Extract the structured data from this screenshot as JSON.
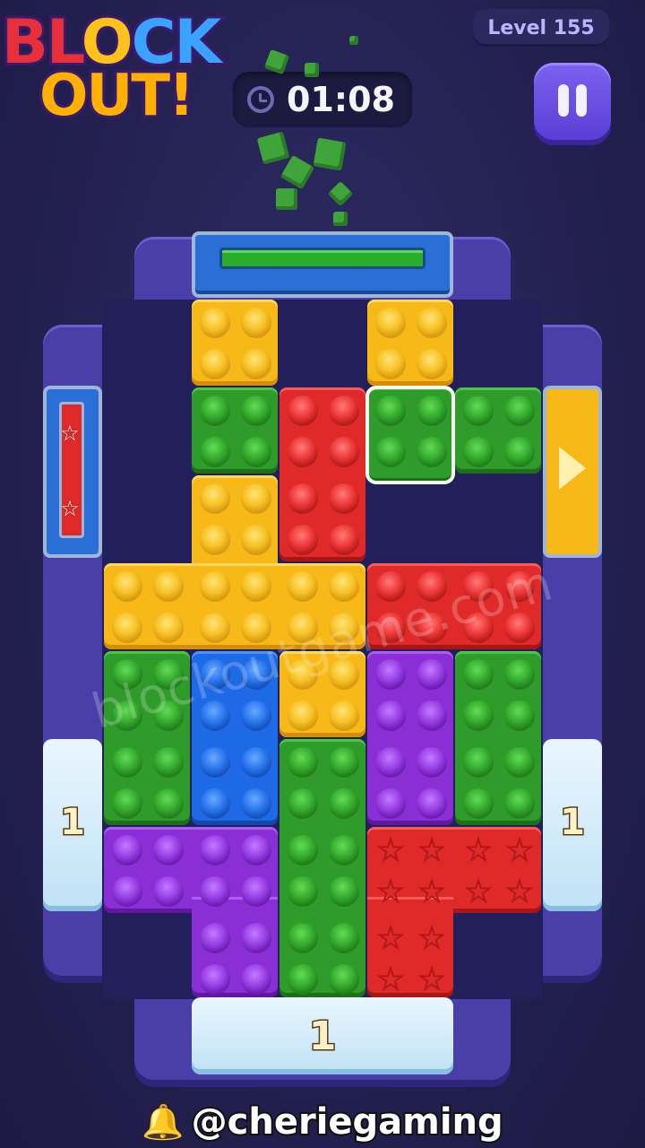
{
  "logo": {
    "line1": [
      "BL",
      "O",
      "CK"
    ],
    "line2": "OUT!"
  },
  "level": {
    "label": "Level 155"
  },
  "timer": {
    "value": "01:08",
    "icon": "clock-icon"
  },
  "pause": {
    "icon": "pause-icon"
  },
  "ice_counters": {
    "left": "1",
    "right": "1",
    "bottom": "1"
  },
  "watermark": "blockoutgame.com",
  "credit": {
    "handle": "@cheriegaming",
    "icon": "bell-icon"
  },
  "colors": {
    "yellow": "#f6b917",
    "green": "#2f9b2a",
    "red": "#e02a2a",
    "blue": "#1e6ae6",
    "purple": "#8a2fd6"
  }
}
